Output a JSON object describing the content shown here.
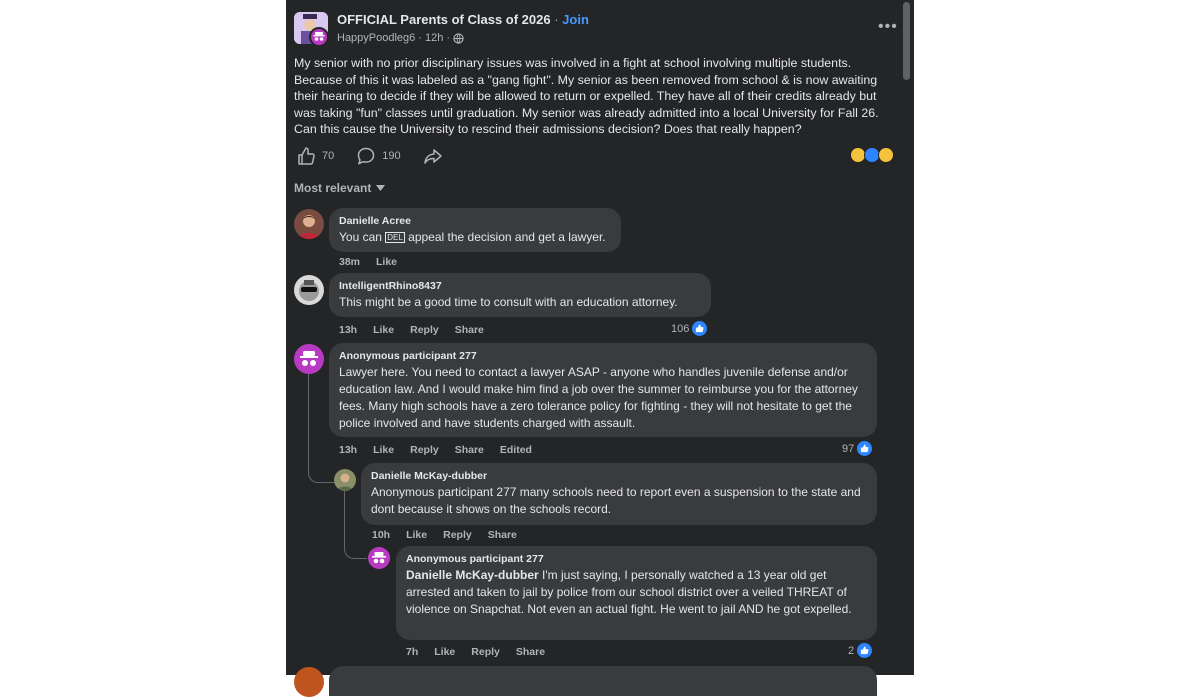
{
  "post": {
    "group_name": "OFFICIAL Parents of Class of 2026",
    "join_label": "Join",
    "author": "HappyPoodle g6",
    "author_display": "HappyPoodleg6",
    "time": "12h",
    "privacy_icon": "globe-icon",
    "body": "My senior with no prior disciplinary issues was involved in a fight at school involving multiple students. Because of this it was labeled as a \"gang fight\". My senior as been removed from school & is now awaiting their hearing to decide if they will be allowed to return or expelled. They have all of their credits already but was taking \"fun\" classes until graduation. My senior was already admitted into a local University for Fall 26. Can this cause the University to rescind their admissions decision? Does that really happen?",
    "like_count": "70",
    "comment_count": "190",
    "more_label": "•••"
  },
  "sort_label": "Most relevant",
  "comments": [
    {
      "name": "Danielle Acree",
      "text_before": "You can ",
      "emoji_text": "DEL",
      "text_after": " appeal the decision and get a lawyer.",
      "time": "38m",
      "like": "Like"
    },
    {
      "name": "IntelligentRhino8437",
      "text": "This might be a good time to consult with an education attorney.",
      "time": "13h",
      "like": "Like",
      "reply": "Reply",
      "share": "Share",
      "reactions": "106"
    },
    {
      "name": "Anonymous participant 277",
      "text": "Lawyer here. You need to contact a lawyer ASAP - anyone who handles juvenile defense and/or education law. And I would make him find a job over the summer to reimburse you for the attorney fees. Many high schools have a zero tolerance policy for fighting - they will not hesitate to get the police involved and have students charged with assault.",
      "time": "13h",
      "like": "Like",
      "reply": "Reply",
      "share": "Share",
      "edited": "Edited",
      "reactions": "97"
    },
    {
      "name": "Danielle McKay-dubber",
      "text": "Anonymous participant 277 many schools need to report even a suspension to the state and dont because it shows on the schools record.",
      "time": "10h",
      "like": "Like",
      "reply": "Reply",
      "share": "Share"
    },
    {
      "name": "Anonymous participant 277",
      "mention": "Danielle McKay-dubber",
      "text": " I'm just saying, I personally watched a 13 year old get arrested and taken to jail by police from our school district over a veiled THREAT of violence on Snapchat. Not even an actual fight. He went to jail AND he got expelled.",
      "time": "7h",
      "like": "Like",
      "reply": "Reply",
      "share": "Share",
      "reactions": "2"
    }
  ],
  "colors": {
    "panel_bg": "#242526",
    "bubble_bg": "#3a3b3c",
    "link_blue": "#4599ff",
    "anon_purple": "#b83ac2",
    "like_blue": "#2d86ff"
  }
}
